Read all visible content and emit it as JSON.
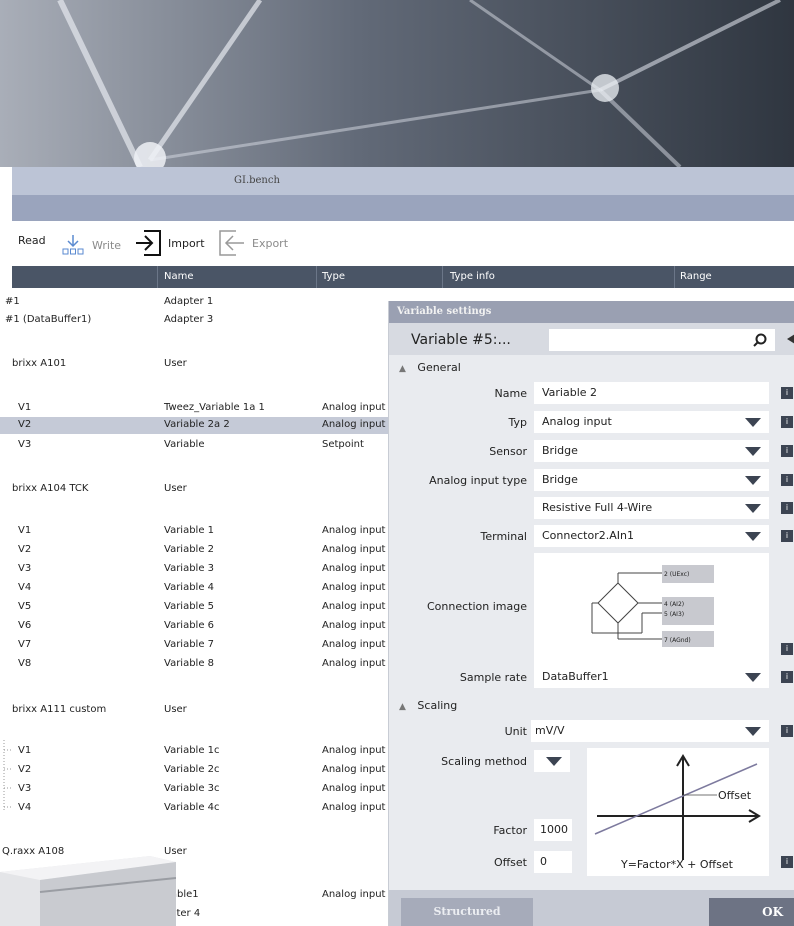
{
  "app": {
    "title": "GI.bench"
  },
  "toolbar": {
    "read": "Read",
    "write": "Write",
    "import": "Import",
    "export": "Export"
  },
  "grid": {
    "columns": [
      "Name",
      "Type",
      "Type info",
      "Range"
    ],
    "rows": [
      {
        "c0": "#1",
        "name": "Adapter 1",
        "type": ""
      },
      {
        "c0": "#1 (DataBuffer1)",
        "name": "Adapter 3",
        "type": ""
      },
      {
        "c0": "brixx A101",
        "name": "User",
        "type": ""
      },
      {
        "c0": "V1",
        "name": "Tweez_Variable 1a 1",
        "type": "Analog input"
      },
      {
        "c0": "V2",
        "name": "Variable 2a 2",
        "type": "Analog input"
      },
      {
        "c0": "V3",
        "name": "Variable",
        "type": "Setpoint"
      },
      {
        "c0": "brixx A104 TCK",
        "name": "User",
        "type": ""
      },
      {
        "c0": "V1",
        "name": "Variable 1",
        "type": "Analog input"
      },
      {
        "c0": "V2",
        "name": "Variable 2",
        "type": "Analog input"
      },
      {
        "c0": "V3",
        "name": "Variable 3",
        "type": "Analog input"
      },
      {
        "c0": "V4",
        "name": "Variable 4",
        "type": "Analog input"
      },
      {
        "c0": "V5",
        "name": "Variable 5",
        "type": "Analog input"
      },
      {
        "c0": "V6",
        "name": "Variable 6",
        "type": "Analog input"
      },
      {
        "c0": "V7",
        "name": "Variable 7",
        "type": "Analog input"
      },
      {
        "c0": "V8",
        "name": "Variable 8",
        "type": "Analog input"
      },
      {
        "c0": "brixx A111 custom",
        "name": "User",
        "type": ""
      },
      {
        "c0": "V1",
        "name": "Variable 1c",
        "type": "Analog input"
      },
      {
        "c0": "V2",
        "name": "Variable 2c",
        "type": "Analog input"
      },
      {
        "c0": "V3",
        "name": "Variable 3c",
        "type": "Analog input"
      },
      {
        "c0": "V4",
        "name": "Variable 4c",
        "type": "Analog input"
      },
      {
        "c0": "Q.raxx A108",
        "name": "User",
        "type": ""
      },
      {
        "c0": "",
        "name": "riable1",
        "type": "Analog input"
      },
      {
        "c0": "",
        "name": "apter 4",
        "type": ""
      }
    ]
  },
  "panel": {
    "header": "Variable settings",
    "variable_title": "Variable #5:...",
    "general_label": "General",
    "fields": {
      "name_label": "Name",
      "name_value": "Variable 2",
      "typ_label": "Typ",
      "typ_value": "Analog input",
      "sensor_label": "Sensor",
      "sensor_value": "Bridge",
      "ait_label": "Analog input type",
      "ait_value": "Bridge",
      "wiring_value": "Resistive Full 4-Wire",
      "terminal_label": "Terminal",
      "terminal_value": "Connector2.AIn1",
      "conn_label": "Connection image",
      "sample_label": "Sample rate",
      "sample_value": "DataBuffer1"
    },
    "conn_pins": [
      "2 (UExc)",
      "4 (AI2)",
      "5 (AI3)",
      "7 (AGnd)"
    ],
    "scaling_label": "Scaling",
    "scaling": {
      "unit_label": "Unit",
      "unit_value": "mV/V",
      "method_label": "Scaling method",
      "factor_label": "Factor",
      "factor_value": "1000",
      "offset_label": "Offset",
      "offset_value": "0",
      "graph_offset": "Offset",
      "formula": "Y=Factor*X + Offset"
    },
    "info_glyph": "i",
    "buttons": {
      "structured": "Structured",
      "ok": "OK"
    }
  }
}
